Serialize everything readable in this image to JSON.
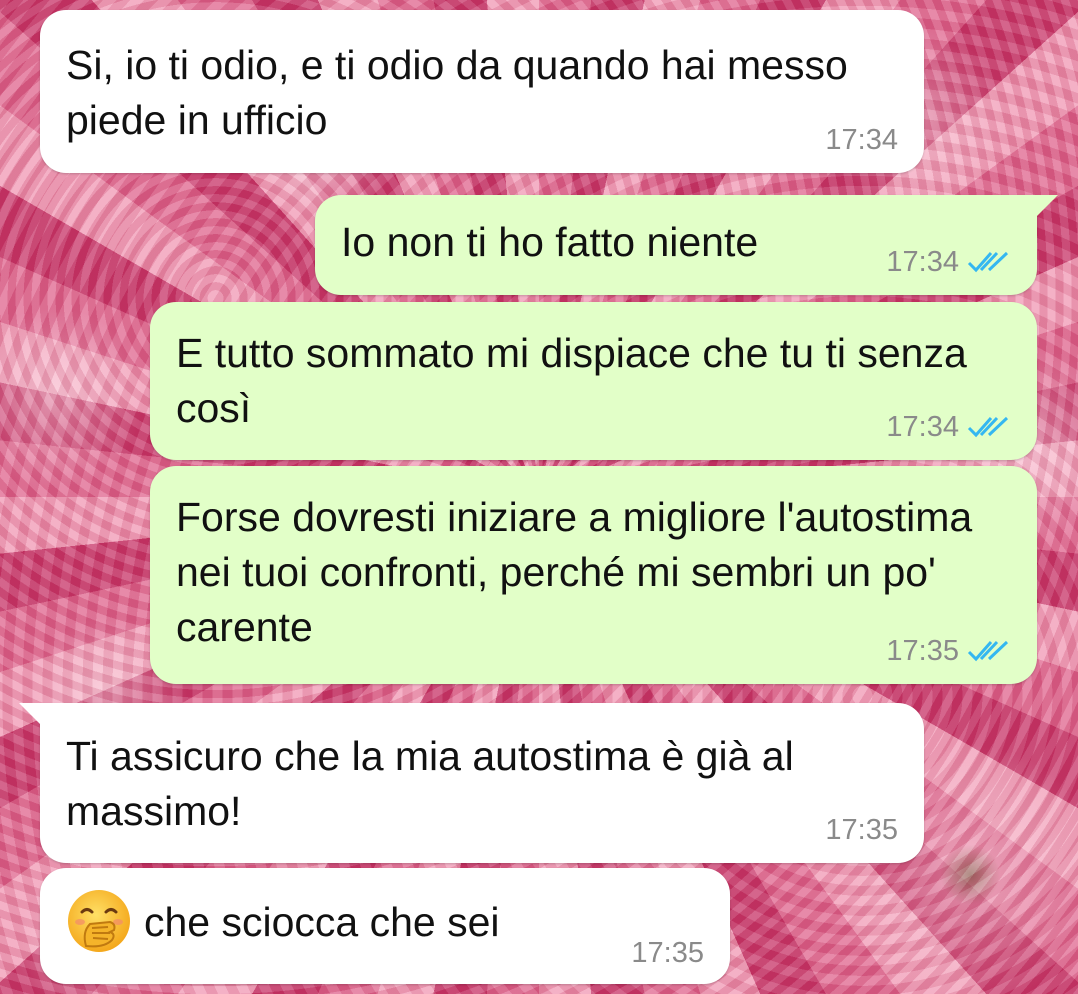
{
  "messages": [
    {
      "id": "m1",
      "direction": "in",
      "text": "Si, io ti odio, e ti odio da quando hai messo piede in ufficio",
      "time": "17:34"
    },
    {
      "id": "m2",
      "direction": "out",
      "text": "Io non ti ho fatto niente",
      "time": "17:34",
      "status": "read"
    },
    {
      "id": "m3",
      "direction": "out",
      "text": "E tutto sommato mi dispiace che tu ti senza così",
      "time": "17:34",
      "status": "read"
    },
    {
      "id": "m4",
      "direction": "out",
      "text": "Forse dovresti iniziare a migliore l'autostima nei tuoi confronti, perché mi sembri un po' carente",
      "time": "17:35",
      "status": "read"
    },
    {
      "id": "m5",
      "direction": "in",
      "text": "Ti assicuro che la mia autostima è già al massimo!",
      "time": "17:35"
    },
    {
      "id": "m6",
      "direction": "in",
      "emoji": "face-with-hand-over-mouth",
      "text": "che sciocca che sei",
      "time": "17:35"
    }
  ],
  "colors": {
    "incoming_bubble": "#ffffff",
    "outgoing_bubble": "#e2ffc8",
    "read_ticks": "#34b7f1",
    "timestamp": "#8a8a8a"
  }
}
